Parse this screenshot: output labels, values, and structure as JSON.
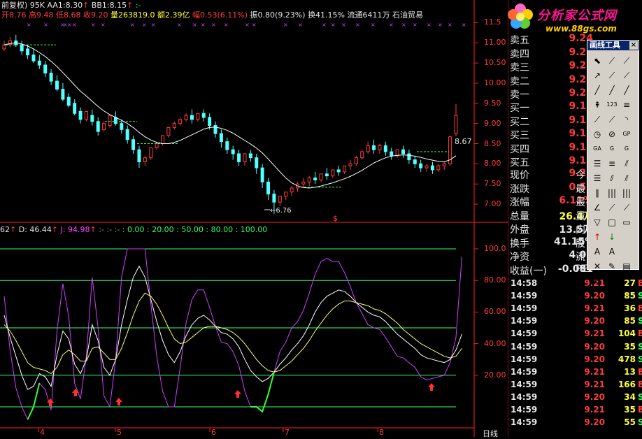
{
  "header": {
    "row1": {
      "title": "前复权)",
      "period": "95K",
      "aa1_label": "AA1:",
      "aa1_value": "8.30",
      "bb1_label": "BB1:",
      "bb1_value": "8.15",
      "extra": ":-"
    },
    "row2": {
      "open": "开8.76",
      "high": "高9.48",
      "low": "低8.68",
      "close": "收9.20",
      "volume": "量263819.0",
      "amount": "额2.39亿",
      "change": "幅0.53(6.11%)",
      "amplitude": "振0.80(9.23%)",
      "turnover": "换41.15%",
      "float": "流通6411万",
      "name": "石油贸易"
    },
    "indicator": {
      "k_tail": "62",
      "d": "D: 46.44",
      "j": "J: 94.98",
      "dashes": ":- :- :-",
      "levels": ": 0.00 : 20.00 : 50.00 : 80.00 : 100.00"
    }
  },
  "price_axis": [
    "11.5",
    "11.00",
    "10.50",
    "10.00",
    "9.50",
    "9.00",
    "8.50",
    "8.00",
    "7.50",
    "7.00"
  ],
  "ind_axis": [
    "100.0",
    "80.00",
    "60.00",
    "40.00",
    "20.00"
  ],
  "date_labels": [
    "4",
    "5",
    "6",
    "7",
    "8"
  ],
  "period_button": "日线",
  "annotations": {
    "low_price": "6.76",
    "last_price": "8.67",
    "dollar": "$"
  },
  "chart_data": {
    "type": "candlestick",
    "ylim": [
      6.55,
      11.75
    ],
    "candles": [
      [
        10.85,
        11.05,
        10.95,
        10.8
      ],
      [
        10.95,
        11.15,
        11.05,
        10.9
      ],
      [
        11.05,
        11.2,
        10.95,
        10.9
      ],
      [
        10.95,
        11.05,
        10.8,
        10.7
      ],
      [
        10.85,
        10.95,
        10.7,
        10.6
      ],
      [
        10.7,
        10.85,
        10.55,
        10.5
      ],
      [
        10.55,
        10.7,
        10.45,
        10.35
      ],
      [
        10.45,
        10.55,
        10.25,
        10.15
      ],
      [
        10.25,
        10.35,
        10.05,
        9.95
      ],
      [
        10.05,
        10.2,
        9.85,
        9.8
      ],
      [
        9.85,
        10.0,
        9.6,
        9.55
      ],
      [
        9.65,
        9.75,
        9.45,
        9.4
      ],
      [
        9.5,
        9.6,
        9.25,
        9.2
      ],
      [
        9.3,
        9.4,
        9.1,
        9.0
      ],
      [
        9.1,
        9.25,
        9.3,
        9.05
      ],
      [
        9.2,
        9.35,
        9.05,
        8.95
      ],
      [
        9.05,
        9.15,
        8.8,
        8.7
      ],
      [
        8.85,
        9.05,
        9.0,
        8.8
      ],
      [
        8.95,
        9.1,
        9.2,
        8.9
      ],
      [
        9.15,
        9.3,
        9.0,
        8.95
      ],
      [
        9.0,
        9.1,
        8.85,
        8.75
      ],
      [
        8.85,
        8.95,
        8.6,
        8.5
      ],
      [
        8.6,
        8.7,
        8.35,
        8.25
      ],
      [
        8.35,
        8.45,
        8.05,
        7.9
      ],
      [
        8.05,
        8.2,
        8.15,
        7.95
      ],
      [
        8.15,
        8.35,
        8.4,
        8.1
      ],
      [
        8.4,
        8.55,
        8.5,
        8.35
      ],
      [
        8.5,
        8.65,
        8.7,
        8.45
      ],
      [
        8.7,
        8.8,
        8.9,
        8.65
      ],
      [
        8.9,
        9.05,
        9.0,
        8.85
      ],
      [
        9.0,
        9.15,
        9.1,
        8.95
      ],
      [
        9.1,
        9.25,
        9.2,
        9.05
      ],
      [
        9.2,
        9.35,
        9.1,
        9.0
      ],
      [
        9.1,
        9.25,
        9.25,
        9.05
      ],
      [
        9.25,
        9.35,
        9.15,
        9.05
      ],
      [
        9.15,
        9.25,
        8.95,
        8.85
      ],
      [
        8.95,
        9.05,
        8.75,
        8.65
      ],
      [
        8.75,
        8.85,
        8.55,
        8.4
      ],
      [
        8.55,
        8.65,
        8.35,
        8.25
      ],
      [
        8.35,
        8.45,
        8.25,
        8.1
      ],
      [
        8.25,
        8.35,
        8.05,
        7.95
      ],
      [
        8.05,
        8.15,
        8.25,
        7.95
      ],
      [
        8.25,
        8.35,
        8.15,
        8.05
      ],
      [
        8.15,
        8.25,
        7.9,
        7.75
      ],
      [
        7.9,
        8.0,
        7.55,
        7.4
      ],
      [
        7.55,
        7.65,
        7.25,
        7.1
      ],
      [
        7.25,
        7.35,
        7.05,
        6.76
      ],
      [
        7.05,
        7.15,
        7.2,
        6.95
      ],
      [
        7.2,
        7.3,
        7.3,
        7.1
      ],
      [
        7.3,
        7.45,
        7.4,
        7.2
      ],
      [
        7.4,
        7.55,
        7.5,
        7.3
      ],
      [
        7.5,
        7.65,
        7.55,
        7.4
      ],
      [
        7.55,
        7.7,
        7.65,
        7.45
      ],
      [
        7.65,
        7.8,
        7.6,
        7.5
      ],
      [
        7.6,
        7.75,
        7.75,
        7.55
      ],
      [
        7.75,
        7.9,
        7.7,
        7.6
      ],
      [
        7.7,
        7.85,
        7.85,
        7.65
      ],
      [
        7.85,
        7.95,
        7.8,
        7.7
      ],
      [
        7.8,
        7.95,
        7.95,
        7.75
      ],
      [
        7.95,
        8.1,
        8.0,
        7.85
      ],
      [
        8.0,
        8.2,
        8.15,
        7.95
      ],
      [
        8.15,
        8.35,
        8.3,
        8.1
      ],
      [
        8.3,
        8.55,
        8.45,
        8.25
      ],
      [
        8.45,
        8.6,
        8.35,
        8.25
      ],
      [
        8.35,
        8.5,
        8.45,
        8.25
      ],
      [
        8.45,
        8.55,
        8.3,
        8.2
      ],
      [
        8.3,
        8.4,
        8.2,
        8.1
      ],
      [
        8.2,
        8.35,
        8.35,
        8.15
      ],
      [
        8.35,
        8.45,
        8.25,
        8.15
      ],
      [
        8.25,
        8.35,
        8.1,
        8.0
      ],
      [
        8.1,
        8.2,
        8.0,
        7.9
      ],
      [
        8.0,
        8.1,
        7.9,
        7.8
      ],
      [
        7.9,
        8.0,
        7.95,
        7.8
      ],
      [
        7.95,
        8.05,
        7.85,
        7.75
      ],
      [
        7.85,
        8.0,
        7.95,
        7.8
      ],
      [
        7.95,
        8.05,
        8.0,
        7.85
      ],
      [
        8.0,
        8.7,
        8.67,
        7.95
      ],
      [
        8.76,
        9.48,
        9.2,
        8.68
      ]
    ],
    "ma": [
      10.95,
      10.98,
      11.0,
      10.97,
      10.92,
      10.85,
      10.76,
      10.66,
      10.54,
      10.41,
      10.26,
      10.11,
      9.95,
      9.8,
      9.68,
      9.55,
      9.42,
      9.31,
      9.22,
      9.15,
      9.08,
      9.0,
      8.9,
      8.78,
      8.67,
      8.59,
      8.53,
      8.5,
      8.5,
      8.53,
      8.58,
      8.65,
      8.72,
      8.79,
      8.86,
      8.9,
      8.91,
      8.88,
      8.83,
      8.76,
      8.67,
      8.58,
      8.49,
      8.39,
      8.27,
      8.12,
      7.96,
      7.8,
      7.65,
      7.53,
      7.45,
      7.41,
      7.4,
      7.42,
      7.45,
      7.49,
      7.53,
      7.58,
      7.63,
      7.69,
      7.76,
      7.84,
      7.93,
      8.02,
      8.09,
      8.15,
      8.19,
      8.21,
      8.22,
      8.21,
      8.19,
      8.16,
      8.12,
      8.09,
      8.06,
      8.05,
      8.1,
      8.2
    ],
    "k": [
      58,
      44,
      32,
      20,
      11,
      13,
      21,
      19,
      13,
      33,
      48,
      43,
      27,
      21,
      30,
      52,
      42,
      25,
      20,
      30,
      52,
      68,
      82,
      89,
      82,
      68,
      54,
      42,
      33,
      28,
      35,
      45,
      52,
      56,
      58,
      55,
      51,
      47,
      46,
      43,
      38,
      30,
      23,
      19,
      16,
      18,
      22,
      27,
      31,
      36,
      40,
      45,
      52,
      60,
      66,
      70,
      72,
      74,
      73,
      70,
      66,
      63,
      60,
      58,
      57,
      54,
      50,
      46,
      43,
      40,
      37,
      33,
      31,
      30,
      29,
      28,
      30,
      36,
      46
    ],
    "d": [
      52,
      48,
      42,
      35,
      28,
      25,
      24,
      23,
      21,
      25,
      33,
      36,
      33,
      29,
      29,
      37,
      38,
      34,
      30,
      30,
      37,
      47,
      58,
      67,
      72,
      70,
      65,
      58,
      50,
      43,
      40,
      41,
      44,
      47,
      50,
      51,
      51,
      50,
      49,
      47,
      44,
      40,
      35,
      30,
      26,
      23,
      22,
      23,
      26,
      29,
      33,
      37,
      42,
      48,
      53,
      58,
      62,
      65,
      67,
      67,
      66,
      65,
      64,
      62,
      61,
      59,
      56,
      53,
      49,
      46,
      43,
      40,
      38,
      36,
      34,
      32,
      31,
      32,
      37
    ],
    "j": [
      70,
      36,
      12,
      0,
      -8,
      0,
      15,
      11,
      -2,
      48,
      78,
      57,
      15,
      5,
      32,
      82,
      50,
      7,
      0,
      30,
      82,
      100,
      100,
      100,
      100,
      65,
      32,
      10,
      0,
      0,
      25,
      53,
      68,
      74,
      74,
      63,
      51,
      41,
      40,
      35,
      26,
      10,
      0,
      0,
      -3,
      8,
      22,
      35,
      41,
      50,
      54,
      61,
      72,
      84,
      92,
      94,
      92,
      92,
      85,
      76,
      66,
      59,
      52,
      50,
      49,
      44,
      38,
      32,
      31,
      28,
      25,
      19,
      17,
      18,
      19,
      20,
      28,
      44,
      95
    ]
  },
  "quote": {
    "asks": [
      {
        "label": "卖五",
        "price": "9.24"
      },
      {
        "label": "卖四",
        "price": "9.23"
      },
      {
        "label": "卖三",
        "price": "9.22"
      },
      {
        "label": "卖二",
        "price": "9.21"
      },
      {
        "label": "卖一",
        "price": "9.20"
      }
    ],
    "bids": [
      {
        "label": "买一",
        "price": "9.19"
      },
      {
        "label": "买二",
        "price": "9.18"
      },
      {
        "label": "买三",
        "price": "9.17"
      },
      {
        "label": "买四",
        "price": "9.16"
      },
      {
        "label": "买五",
        "price": "9.15"
      }
    ],
    "stats": [
      {
        "label": "现价",
        "value": "9.20",
        "tail": "今"
      },
      {
        "label": "涨跌",
        "value": "0.53",
        "tail": "最"
      },
      {
        "label": "涨幅",
        "value": "6.11%",
        "tail": "最"
      },
      {
        "label": "总量",
        "value": "26.4万",
        "tail": "量"
      },
      {
        "label": "外盘",
        "value": "13.5万",
        "tail": "内"
      },
      {
        "label": "换手",
        "value": "41.15%",
        "tail": "股"
      },
      {
        "label": "净资",
        "value": "4.09",
        "tail": "流"
      },
      {
        "label": "收益(一)",
        "value": "-0.081",
        "tail": "PE"
      }
    ],
    "ticks": [
      {
        "time": "14:58",
        "price": "9.21",
        "vol": "27",
        "dir": "B"
      },
      {
        "time": "14:59",
        "price": "9.20",
        "vol": "85",
        "dir": "S"
      },
      {
        "time": "14:59",
        "price": "9.21",
        "vol": "36",
        "dir": "B"
      },
      {
        "time": "14:59",
        "price": "9.20",
        "vol": "85",
        "dir": "S"
      },
      {
        "time": "14:59",
        "price": "9.21",
        "vol": "104",
        "dir": "B"
      },
      {
        "time": "14:59",
        "price": "9.20",
        "vol": "35",
        "dir": "S"
      },
      {
        "time": "14:59",
        "price": "9.20",
        "vol": "478",
        "dir": "S"
      },
      {
        "time": "14:59",
        "price": "9.21",
        "vol": "13",
        "dir": "B"
      },
      {
        "time": "14:59",
        "price": "9.21",
        "vol": "166",
        "dir": "B"
      },
      {
        "time": "14:59",
        "price": "9.20",
        "vol": "34",
        "dir": "S"
      },
      {
        "time": "14:59",
        "price": "9.21",
        "vol": "35",
        "dir": "B"
      },
      {
        "time": "14:59",
        "price": "9.20",
        "vol": "55",
        "dir": "S"
      }
    ]
  },
  "toolbox": {
    "title": "画线工具",
    "close": "×",
    "tools": [
      "⬉",
      "⟋",
      "⟋",
      "↗",
      "⟋",
      "⟋",
      "╱",
      "╱",
      "╱",
      "⇞",
      "123",
      "≡",
      "⟋",
      "⟋",
      "◝",
      "◷",
      "⊘",
      "GP",
      "GA",
      "G",
      "G",
      "☰",
      "≡",
      "⫽",
      "☰",
      "⫽",
      "⫽",
      "∥",
      "|||",
      "|||",
      "∠",
      "⟋",
      "⟋",
      "▽",
      "□",
      "▭",
      "↑",
      "↓",
      "",
      "A",
      "A",
      "",
      "✕",
      "✎",
      "▤",
      "▭",
      "▣",
      ""
    ],
    "colors": {
      "title_bg": "#0a246a",
      "bg": "#d4d0c8"
    }
  },
  "logo": {
    "text": "分析家公式网",
    "url_text": "www.88gs.com"
  },
  "colors": {
    "up": "#ff3c3c",
    "down": "#54ffff",
    "ma": "#ffffff",
    "k": "#ffffff",
    "d": "#ffff66",
    "j": "#d040ff",
    "grid": "#33cc33",
    "frame": "#ff2020",
    "level": "#33ff66"
  }
}
